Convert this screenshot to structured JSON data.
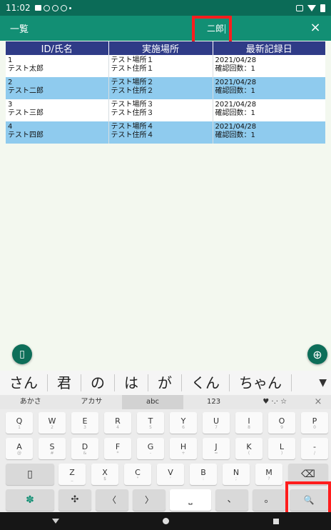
{
  "status": {
    "time": "11:02"
  },
  "appbar": {
    "title": "一覧",
    "search_text": "二郎",
    "close": "×"
  },
  "table": {
    "headers": [
      "ID/氏名",
      "実施場所",
      "最新記録日"
    ],
    "rows": [
      {
        "id": "1",
        "name": "テスト太郎",
        "place": "テスト場所１",
        "address": "テスト住所１",
        "date": "2021/04/28",
        "count": "確認回数：1"
      },
      {
        "id": "2",
        "name": "テスト二郎",
        "place": "テスト場所２",
        "address": "テスト住所２",
        "date": "2021/04/28",
        "count": "確認回数：1"
      },
      {
        "id": "3",
        "name": "テスト三郎",
        "place": "テスト場所３",
        "address": "テスト住所３",
        "date": "2021/04/28",
        "count": "確認回数：1"
      },
      {
        "id": "4",
        "name": "テスト四郎",
        "place": "テスト場所４",
        "address": "テスト住所４",
        "date": "2021/04/28",
        "count": "確認回数：1"
      }
    ]
  },
  "fab": {
    "left_icon": "▯",
    "right_icon": "⊕"
  },
  "suggestions": [
    "さん",
    "君",
    "の",
    "は",
    "が",
    "くん",
    "ちゃん"
  ],
  "suggest_expand": "▼",
  "modes": [
    "あかさ",
    "アカサ",
    "abc",
    "123",
    "♥ ·.· ☆",
    "×"
  ],
  "keys": {
    "row1": [
      {
        "k": "Q",
        "s": "1"
      },
      {
        "k": "W",
        "s": "2"
      },
      {
        "k": "E",
        "s": "3"
      },
      {
        "k": "R",
        "s": "4"
      },
      {
        "k": "T",
        "s": "5"
      },
      {
        "k": "Y",
        "s": "6"
      },
      {
        "k": "U",
        "s": "7"
      },
      {
        "k": "I",
        "s": "8"
      },
      {
        "k": "O",
        "s": "9"
      },
      {
        "k": "P",
        "s": "0"
      }
    ],
    "row2": [
      {
        "k": "A",
        "s": "@"
      },
      {
        "k": "S",
        "s": "#"
      },
      {
        "k": "D",
        "s": "&"
      },
      {
        "k": "F",
        "s": "*"
      },
      {
        "k": "G",
        "s": "-"
      },
      {
        "k": "H",
        "s": "+"
      },
      {
        "k": "J",
        "s": "="
      },
      {
        "k": "K",
        "s": "("
      },
      {
        "k": "L",
        "s": ")"
      },
      {
        "k": "-",
        "s": "/"
      }
    ],
    "row3": [
      {
        "k": "Z",
        "s": "_"
      },
      {
        "k": "X",
        "s": "$"
      },
      {
        "k": "C",
        "s": "\""
      },
      {
        "k": "V",
        "s": "'"
      },
      {
        "k": "B",
        "s": ":"
      },
      {
        "k": "N",
        "s": ";"
      },
      {
        "k": "M",
        "s": "?"
      }
    ],
    "shift": "▯",
    "backspace": "⌫",
    "settings": "✽",
    "cursor": "✣",
    "left": "〈",
    "right": "〉",
    "space": "⎵",
    "comma": "、",
    "period": "。",
    "search": "🔍"
  }
}
